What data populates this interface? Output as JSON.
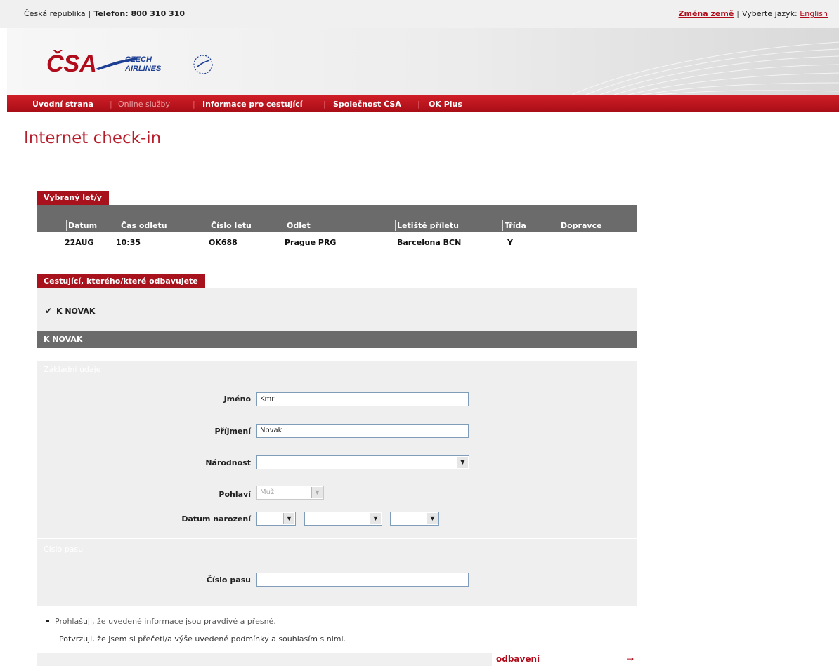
{
  "topbar": {
    "country": "Česká republika",
    "phone": "Telefon: 800 310 310",
    "change_country": "Změna země",
    "choose_lang_label": "Vyberte jazyk:",
    "lang_link": "English"
  },
  "logo": {
    "brand": "ČSA",
    "line1": "CZECH",
    "line2": "AIRLINES"
  },
  "nav": {
    "items": [
      "Úvodní strana",
      "Online služby",
      "Informace pro cestující",
      "Společnost ČSA",
      "OK Plus"
    ]
  },
  "page_title": "Internet check-in",
  "flights": {
    "tab": "Vybraný let/y",
    "headers": [
      "Datum",
      "Čas odletu",
      "Číslo letu",
      "Odlet",
      "Letiště příletu",
      "Třída",
      "Dopravce"
    ],
    "row": [
      "22AUG",
      "10:35",
      "OK688",
      "Prague PRG",
      "Barcelona BCN",
      "Y",
      ""
    ]
  },
  "passengers": {
    "tab": "Cestující, kterého/které odbavujete",
    "checked_name": "K NOVAK",
    "selected_header": "K NOVAK"
  },
  "form": {
    "basic_section": "Základní údaje",
    "first_name_label": "Jméno",
    "first_name_value": "Kmr",
    "last_name_label": "Příjmení",
    "last_name_value": "Novak",
    "nationality_label": "Národnost",
    "nationality_value": "",
    "gender_label": "Pohlaví",
    "gender_value": "Muž",
    "dob_label": "Datum narození",
    "passport_section": "Číslo pasu",
    "passport_label": "Číslo pasu",
    "passport_value": ""
  },
  "notes": {
    "declaration": "Prohlašuji, že uvedené informace jsou pravdivé a přesné.",
    "confirm": "Potvrzuji, že jsem si přečetl/a výše uvedené podmínky a souhlasím s nimi."
  },
  "actions": {
    "checkin": "odbavení"
  },
  "colors": {
    "brand_red": "#b00c1c",
    "gray_header": "#6b6b6b"
  }
}
